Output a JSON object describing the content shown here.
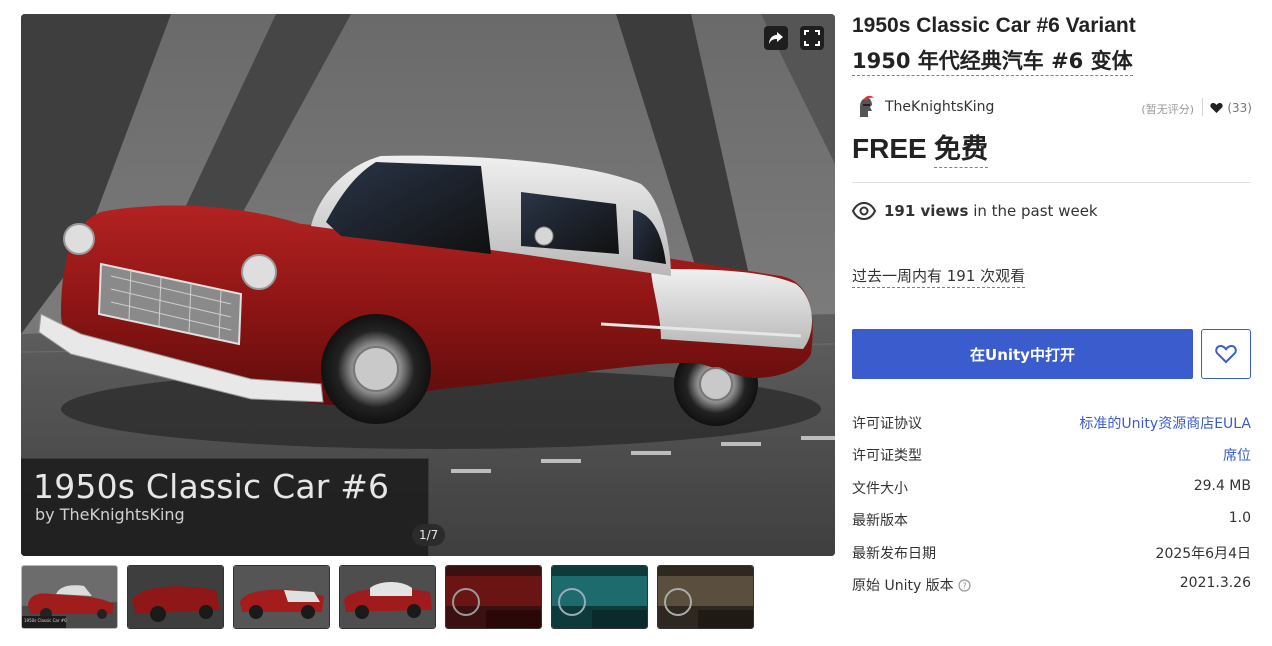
{
  "gallery": {
    "caption_title": "1950s Classic Car #6",
    "caption_by": "by TheKnightsKing",
    "counter": "1/7",
    "thumb_caption": "1950s Classic Car #6",
    "thumbnails": 7
  },
  "product": {
    "title_en": "1950s Classic Car #6 Variant",
    "title_zh": "1950 年代经典汽车 #6 变体",
    "publisher": "TheKnightsKing",
    "rating_text": "(暂无评分)",
    "favorites": "(33)",
    "price": "FREE",
    "price_zh": "免费",
    "views_count": "191 views",
    "views_suffix": " in the past week",
    "views_zh": "过去一周内有 191 次观看",
    "open_button": "在Unity中打开"
  },
  "details": [
    {
      "label": "许可证协议",
      "value": "标准的Unity资源商店EULA",
      "link": true
    },
    {
      "label": "许可证类型",
      "value": "席位",
      "link": true
    },
    {
      "label": "文件大小",
      "value": "29.4 MB",
      "link": false
    },
    {
      "label": "最新版本",
      "value": "1.0",
      "link": false
    },
    {
      "label": "最新发布日期",
      "value": "2025年6月4日",
      "link": false
    },
    {
      "label": "原始 Unity 版本",
      "value": "2021.3.26",
      "link": false
    }
  ],
  "colors": {
    "accent": "#3a5ccc",
    "car_body": "#9e1a1a",
    "car_roof": "#d8d8d8",
    "teal_interior": "#1e6b6e"
  },
  "icons": [
    "share-icon",
    "fullscreen-icon",
    "heart-icon",
    "eye-icon",
    "help-circle-icon",
    "knight-avatar"
  ]
}
